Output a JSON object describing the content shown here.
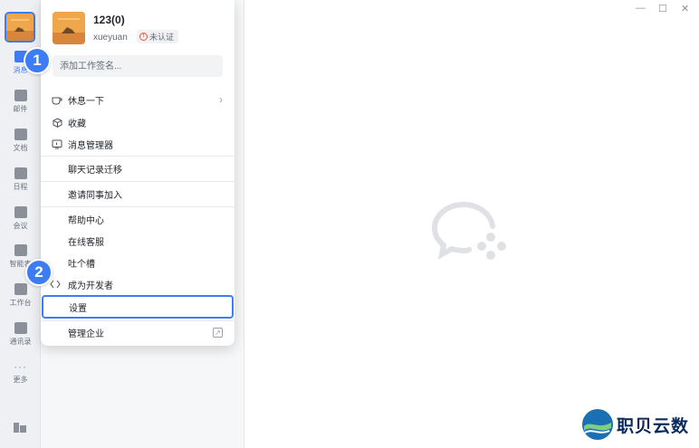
{
  "rail": {
    "items": [
      {
        "label": "消息",
        "icon": "chat-icon"
      },
      {
        "label": "邮件",
        "icon": "mail-icon"
      },
      {
        "label": "文档",
        "icon": "document-icon"
      },
      {
        "label": "日程",
        "icon": "calendar-icon"
      },
      {
        "label": "会议",
        "icon": "meeting-icon"
      },
      {
        "label": "智能表",
        "icon": "smartsheet-icon"
      },
      {
        "label": "工作台",
        "icon": "workbench-icon"
      },
      {
        "label": "通讯录",
        "icon": "contacts-icon"
      },
      {
        "label": "更多",
        "icon": "more-icon"
      }
    ]
  },
  "profile": {
    "name": "123(0)",
    "username": "xueyuan",
    "status_badge": "未认证",
    "signature_placeholder": "添加工作签名..."
  },
  "menu": {
    "break": "休息一下",
    "favorites": "收藏",
    "message_manager": "消息管理器",
    "chat_migration": "聊天记录迁移",
    "invite": "邀请同事加入",
    "help": "帮助中心",
    "online_service": "在线客服",
    "feedback": "吐个槽",
    "developer": "成为开发者",
    "settings": "设置",
    "manage_enterprise": "管理企业"
  },
  "steps": {
    "one": "1",
    "two": "2"
  },
  "watermark": {
    "text": "职贝云数"
  },
  "colors": {
    "accent": "#3c7df5",
    "menu_bg": "#ffffff",
    "rail_bg": "#eef0f3"
  }
}
